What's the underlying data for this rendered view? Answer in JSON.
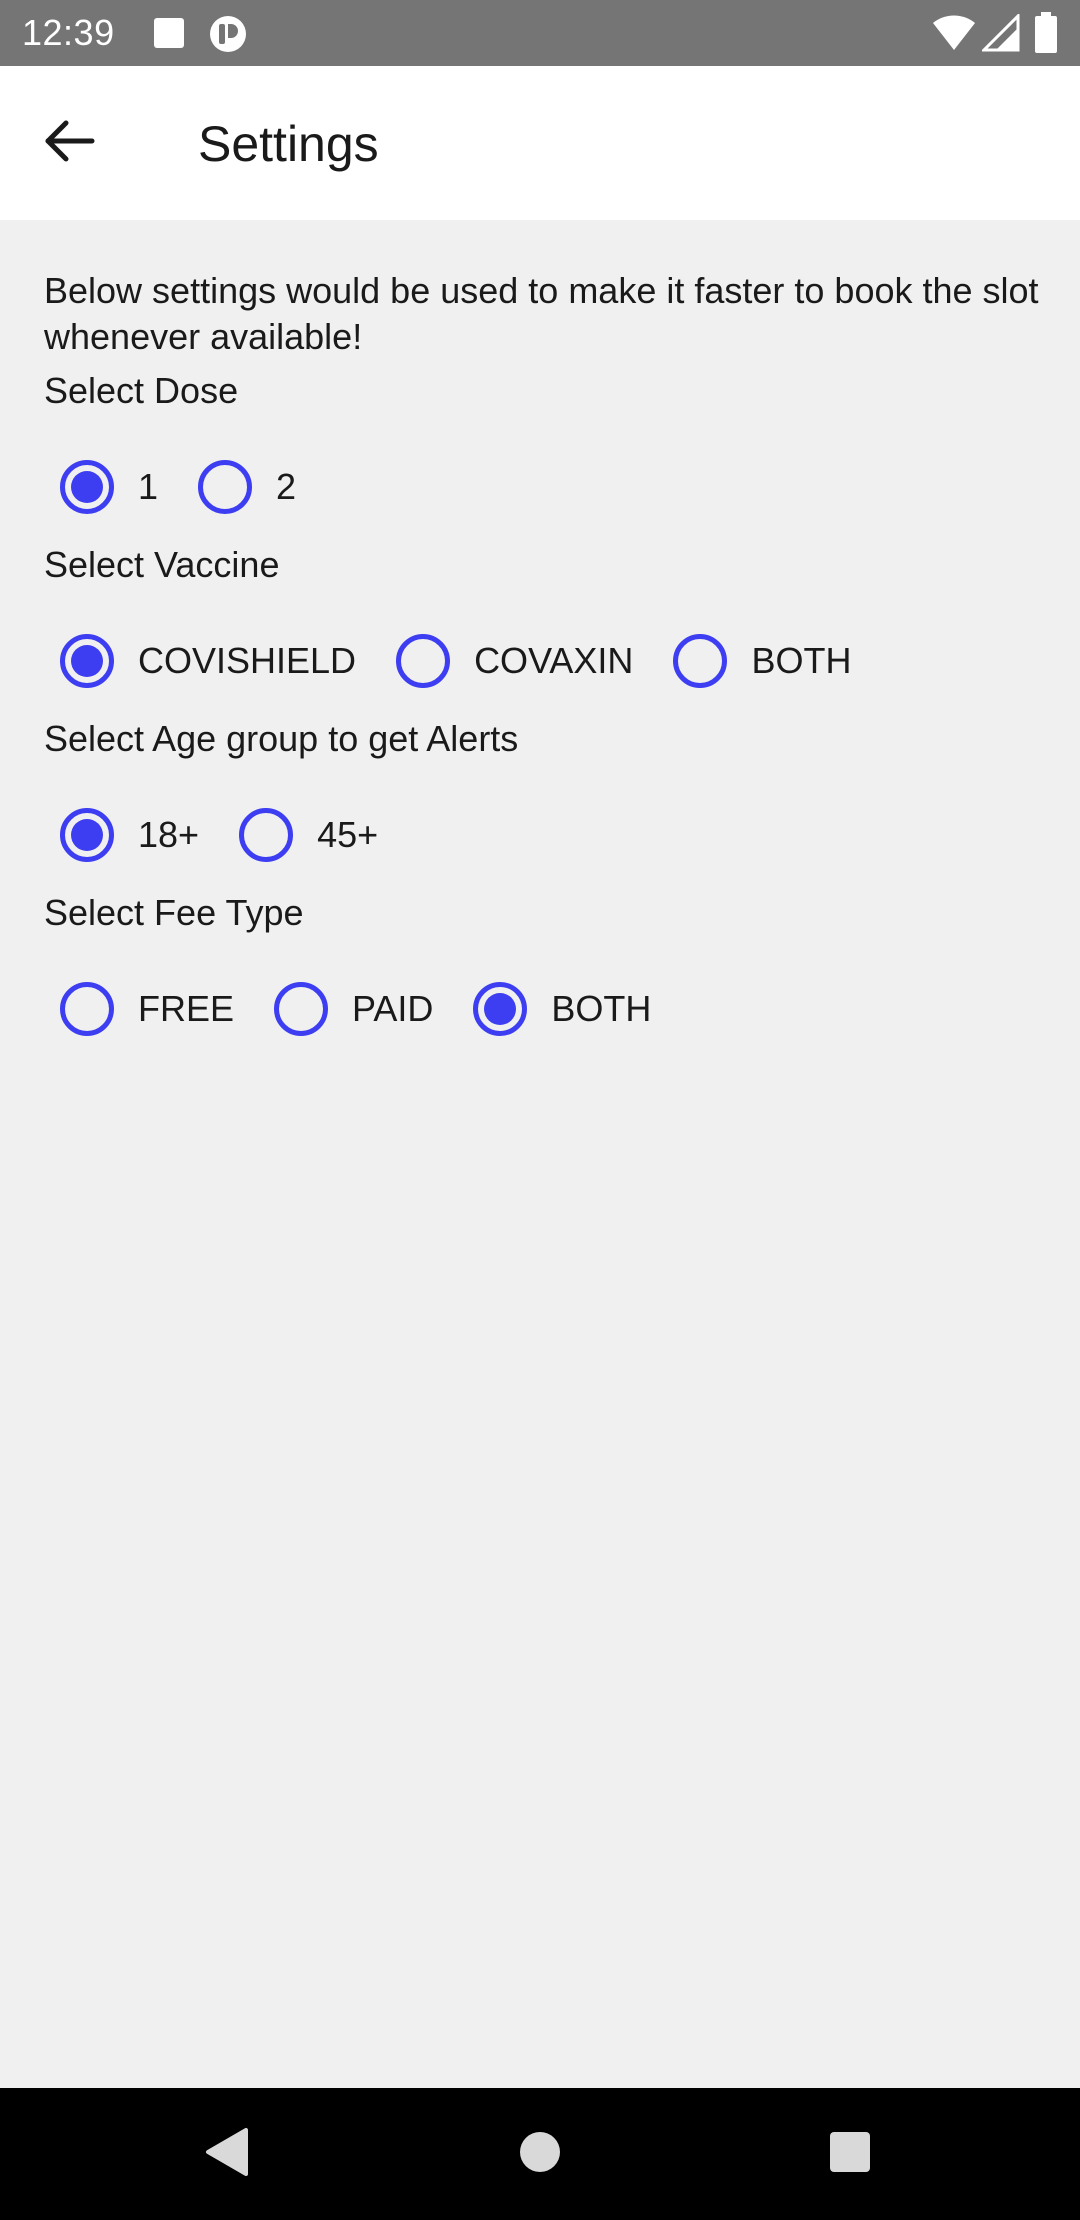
{
  "status_bar": {
    "time": "12:39"
  },
  "app_bar": {
    "title": "Settings",
    "back_icon": "arrow-back-icon"
  },
  "description": "Below settings would be used to make it faster to book the slot whenever available!",
  "sections": {
    "dose": {
      "label": "Select Dose",
      "options": [
        "1",
        "2"
      ],
      "selected": "1"
    },
    "vaccine": {
      "label": "Select Vaccine",
      "options": [
        "COVISHIELD",
        "COVAXIN",
        "BOTH"
      ],
      "selected": "COVISHIELD"
    },
    "age_group": {
      "label": "Select Age group to get Alerts",
      "options": [
        "18+",
        "45+"
      ],
      "selected": "18+"
    },
    "fee_type": {
      "label": "Select Fee Type",
      "options": [
        "FREE",
        "PAID",
        "BOTH"
      ],
      "selected": "BOTH"
    }
  },
  "colors": {
    "accent": "#3d3df2",
    "status_bar": "#757575",
    "background": "#f0f0f0"
  },
  "nav_bar": {
    "icons": [
      "back-triangle-icon",
      "home-circle-icon",
      "recents-square-icon"
    ]
  }
}
